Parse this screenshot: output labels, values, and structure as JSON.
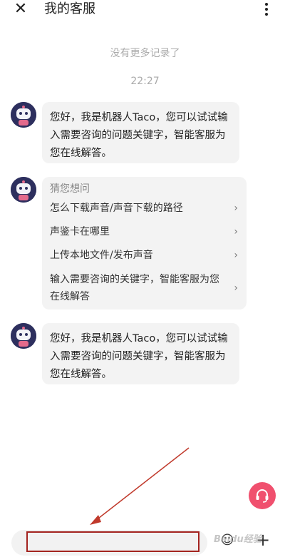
{
  "header": {
    "close_icon": "close-icon",
    "title": "我的客服",
    "more_icon": "more-vertical-icon"
  },
  "chat": {
    "no_more_records": "没有更多记录了",
    "timestamp": "22:27",
    "messages": [
      {
        "sender": "bot",
        "avatar": "robot-avatar",
        "text": "您好，我是机器人Taco，您可以试试输入需要咨询的问题关键字，智能客服为您在线解答。"
      },
      {
        "sender": "bot",
        "avatar": "robot-avatar",
        "heading": "猜您想问",
        "suggestions": [
          "怎么下载声音/声音下载的路径",
          "声鉴卡在哪里",
          "上传本地文件/发布声音",
          "输入需要咨询的关键字，智能客服为您在线解答"
        ]
      },
      {
        "sender": "bot",
        "avatar": "robot-avatar",
        "text": "您好，我是机器人Taco，您可以试试输入需要咨询的问题关键字，智能客服为您在线解答。"
      }
    ]
  },
  "input": {
    "value": "",
    "placeholder": ""
  },
  "bottom": {
    "emoji_icon": "emoji-icon",
    "plus_icon": "plus-icon",
    "agent_icon": "headset-icon"
  },
  "colors": {
    "agent_button": "#f0506e",
    "highlight": "#a3231f",
    "bubble": "#f3f3f3"
  },
  "watermark": "Baidu经验"
}
